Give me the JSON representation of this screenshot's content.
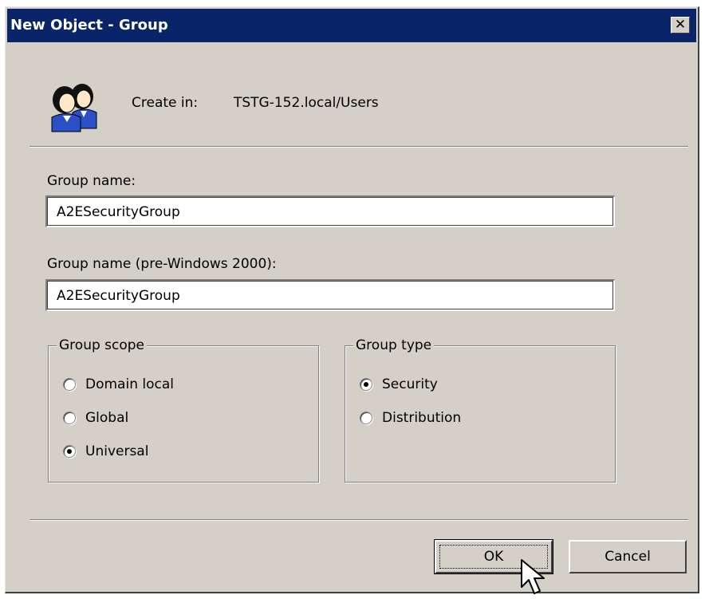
{
  "window": {
    "title": "New Object - Group",
    "close_glyph": "✕"
  },
  "header": {
    "icon": "group-users-icon",
    "create_in_label": "Create in:",
    "create_in_path": "TSTG-152.local/Users"
  },
  "form": {
    "group_name_label": "Group name:",
    "group_name_value": "A2ESecurityGroup",
    "pre2000_label": "Group name (pre-Windows 2000):",
    "pre2000_value": "A2ESecurityGroup"
  },
  "group_scope": {
    "legend": "Group scope",
    "options": [
      {
        "label": "Domain local",
        "checked": false
      },
      {
        "label": "Global",
        "checked": false
      },
      {
        "label": "Universal",
        "checked": true
      }
    ]
  },
  "group_type": {
    "legend": "Group type",
    "options": [
      {
        "label": "Security",
        "checked": true
      },
      {
        "label": "Distribution",
        "checked": false
      }
    ]
  },
  "buttons": {
    "ok": "OK",
    "cancel": "Cancel"
  },
  "colors": {
    "titlebar": "#0a246a",
    "dialog_face": "#d4d0c8"
  }
}
